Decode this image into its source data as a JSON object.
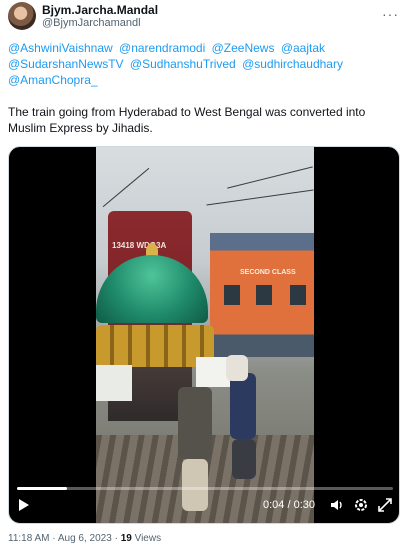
{
  "author": {
    "display_name": "Bjym.Jarcha.Mandal",
    "handle": "@BjymJarchamandl"
  },
  "mentions": [
    "@AshwiniVaishnaw",
    "@narendramodi",
    "@ZeeNews",
    "@aajtak",
    "@SudarshanNewsTV",
    "@SudhanshuTrived",
    "@sudhirchaudhary",
    "@AmanChopra_"
  ],
  "tweet": {
    "text": "The train going from Hyderabad to West Bengal was converted into Muslim Express by Jihadis."
  },
  "video": {
    "locomotive_number": "13418 WDG3A",
    "coach_label": "SECOND CLASS",
    "time_display": "0:04 / 0:30",
    "progress": 0.133
  },
  "footer": {
    "time": "11:18 AM",
    "date": "Aug 6, 2023",
    "views_count": "19",
    "views_label": "Views"
  },
  "colors": {
    "link": "#1d9bf0",
    "secondary_text": "#536471"
  },
  "icons": [
    "more-icon",
    "play-icon",
    "volume-icon",
    "settings-icon",
    "fullscreen-icon"
  ]
}
